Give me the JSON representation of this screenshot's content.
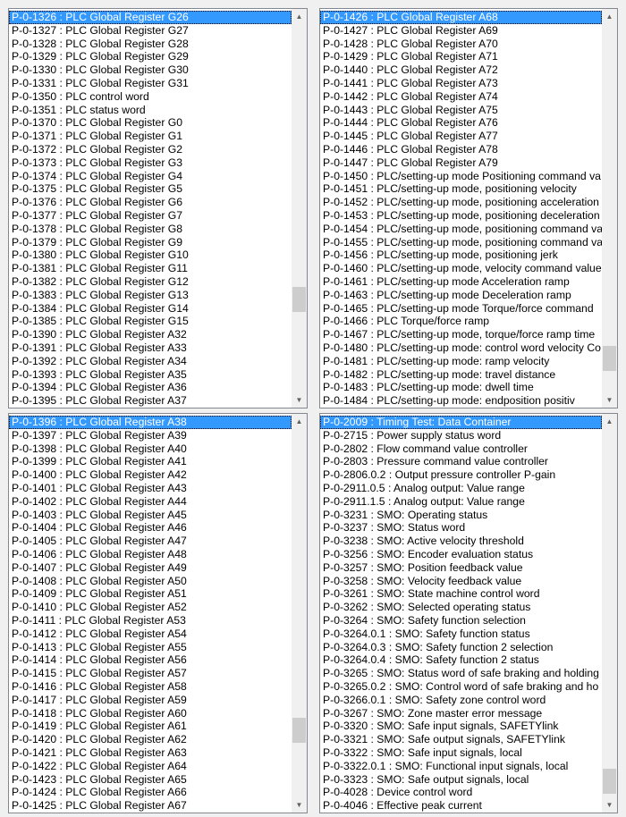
{
  "lists": {
    "top_left": {
      "items": [
        "P-0-1326 : PLC Global Register G26",
        "P-0-1327 : PLC Global Register G27",
        "P-0-1328 : PLC Global Register G28",
        "P-0-1329 : PLC Global Register G29",
        "P-0-1330 : PLC Global Register G30",
        "P-0-1331 : PLC Global Register G31",
        "P-0-1350 : PLC control word",
        "P-0-1351 : PLC status word",
        "P-0-1370 : PLC Global Register G0",
        "P-0-1371 : PLC Global Register G1",
        "P-0-1372 : PLC Global Register G2",
        "P-0-1373 : PLC Global Register G3",
        "P-0-1374 : PLC Global Register G4",
        "P-0-1375 : PLC Global Register G5",
        "P-0-1376 : PLC Global Register G6",
        "P-0-1377 : PLC Global Register G7",
        "P-0-1378 : PLC Global Register G8",
        "P-0-1379 : PLC Global Register G9",
        "P-0-1380 : PLC Global Register G10",
        "P-0-1381 : PLC Global Register G11",
        "P-0-1382 : PLC Global Register G12",
        "P-0-1383 : PLC Global Register G13",
        "P-0-1384 : PLC Global Register G14",
        "P-0-1385 : PLC Global Register G15",
        "P-0-1390 : PLC Global Register A32",
        "P-0-1391 : PLC Global Register A33",
        "P-0-1392 : PLC Global Register A34",
        "P-0-1393 : PLC Global Register A35",
        "P-0-1394 : PLC Global Register A36",
        "P-0-1395 : PLC Global Register A37"
      ],
      "selected": "P-0-1326 : PLC Global Register G26",
      "scroll_position": 0.87
    },
    "top_right": {
      "items": [
        "P-0-1426 : PLC Global Register A68",
        "P-0-1427 : PLC Global Register A69",
        "P-0-1428 : PLC Global Register A70",
        "P-0-1429 : PLC Global Register A71",
        "P-0-1440 : PLC Global Register A72",
        "P-0-1441 : PLC Global Register A73",
        "P-0-1442 : PLC Global Register A74",
        "P-0-1443 : PLC Global Register A75",
        "P-0-1444 : PLC Global Register A76",
        "P-0-1445 : PLC Global Register A77",
        "P-0-1446 : PLC Global Register A78",
        "P-0-1447 : PLC Global Register A79",
        "P-0-1450 : PLC/setting-up mode Positioning command va",
        "P-0-1451 : PLC/setting-up mode, positioning velocity",
        "P-0-1452 : PLC/setting-up mode, positioning acceleration",
        "P-0-1453 : PLC/setting-up mode, positioning deceleration",
        "P-0-1454 : PLC/setting-up mode, positioning command va",
        "P-0-1455 : PLC/setting-up mode, positioning command va",
        "P-0-1456 : PLC/setting-up mode, positioning jerk",
        "P-0-1460 : PLC/setting-up mode, velocity command value",
        "P-0-1461 : PLC/setting-up mode Acceleration ramp",
        "P-0-1463 : PLC/setting-up mode Deceleration ramp",
        "P-0-1465 : PLC/setting-up mode Torque/force command",
        "P-0-1466 : PLC Torque/force ramp",
        "P-0-1467 : PLC/setting-up mode, torque/force ramp time",
        "P-0-1480 : PLC/setting-up mode: control word velocity Co",
        "P-0-1481 : PLC/setting-up mode: ramp velocity",
        "P-0-1482 : PLC/setting-up mode: travel distance",
        "P-0-1483 : PLC/setting-up mode: dwell time",
        "P-0-1484 : PLC/setting-up mode: endposition positiv"
      ],
      "selected": "P-0-1426 : PLC Global Register A68",
      "scroll_position": 0.91
    },
    "bottom_left": {
      "items": [
        "P-0-1396 : PLC Global Register A38",
        "P-0-1397 : PLC Global Register A39",
        "P-0-1398 : PLC Global Register A40",
        "P-0-1399 : PLC Global Register A41",
        "P-0-1400 : PLC Global Register A42",
        "P-0-1401 : PLC Global Register A43",
        "P-0-1402 : PLC Global Register A44",
        "P-0-1403 : PLC Global Register A45",
        "P-0-1404 : PLC Global Register A46",
        "P-0-1405 : PLC Global Register A47",
        "P-0-1406 : PLC Global Register A48",
        "P-0-1407 : PLC Global Register A49",
        "P-0-1408 : PLC Global Register A50",
        "P-0-1409 : PLC Global Register A51",
        "P-0-1410 : PLC Global Register A52",
        "P-0-1411 : PLC Global Register A53",
        "P-0-1412 : PLC Global Register A54",
        "P-0-1413 : PLC Global Register A55",
        "P-0-1414 : PLC Global Register A56",
        "P-0-1415 : PLC Global Register A57",
        "P-0-1416 : PLC Global Register A58",
        "P-0-1417 : PLC Global Register A59",
        "P-0-1418 : PLC Global Register A60",
        "P-0-1419 : PLC Global Register A61",
        "P-0-1420 : PLC Global Register A62",
        "P-0-1421 : PLC Global Register A63",
        "P-0-1422 : PLC Global Register A64",
        "P-0-1423 : PLC Global Register A65",
        "P-0-1424 : PLC Global Register A66",
        "P-0-1425 : PLC Global Register A67"
      ],
      "selected": "P-0-1396 : PLC Global Register A38",
      "scroll_position": 0.89
    },
    "bottom_right": {
      "items": [
        "P-0-2009 : Timing Test: Data Container",
        "P-0-2715 : Power supply status word",
        "P-0-2802 : Flow command value controller",
        "P-0-2803 : Pressure command value controller",
        "P-0-2806.0.2 : Output pressure controller P-gain",
        "P-0-2911.0.5 : Analog output: Value range",
        "P-0-2911.1.5 : Analog output: Value range",
        "P-0-3231 : SMO: Operating status",
        "P-0-3237 : SMO: Status word",
        "P-0-3238 : SMO: Active velocity threshold",
        "P-0-3256 : SMO: Encoder evaluation status",
        "P-0-3257 : SMO: Position feedback value",
        "P-0-3258 : SMO: Velocity feedback value",
        "P-0-3261 : SMO: State machine control word",
        "P-0-3262 : SMO: Selected operating status",
        "P-0-3264 : SMO: Safety function selection",
        "P-0-3264.0.1 : SMO: Safety function status",
        "P-0-3264.0.3 : SMO: Safety function 2 selection",
        "P-0-3264.0.4 : SMO: Safety function 2 status",
        "P-0-3265 : SMO: Status word of safe braking and holding",
        "P-0-3265.0.2 : SMO: Control word of safe braking and ho",
        "P-0-3266.0.1 : SMO: Safety zone control word",
        "P-0-3267 : SMO: Zone master error message",
        "P-0-3320 : SMO: Safe input signals, SAFETYlink",
        "P-0-3321 : SMO: Safe output signals, SAFETYlink",
        "P-0-3322 : SMO: Safe input signals, local",
        "P-0-3322.0.1 : SMO: Functional input signals, local",
        "P-0-3323 : SMO: Safe output signals, local",
        "P-0-4028 : Device control word",
        "P-0-4046 : Effective peak current"
      ],
      "selected": "P-0-2009 : Timing Test: Data Container",
      "scroll_position": 0.97
    }
  },
  "scrollbar": {
    "up_arrow": "▲",
    "down_arrow": "▼"
  },
  "colors": {
    "selection": "#3399ff",
    "background": "#f0f0f0",
    "thumb": "#cdcdcd"
  }
}
